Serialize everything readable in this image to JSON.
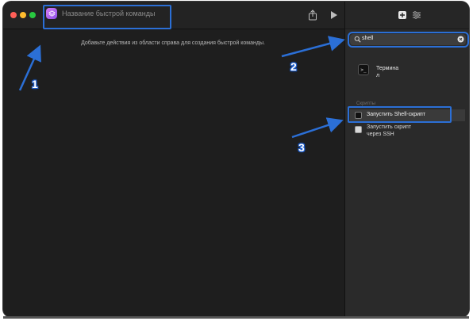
{
  "window": {
    "title": "Название быстрой команды",
    "placeholder_text": "Добавьте действия из области справа для создания быстрой команды."
  },
  "sidebar": {
    "search": {
      "value": "shell"
    },
    "results": [
      {
        "icon": "terminal-icon",
        "label": "Термина\nл"
      }
    ],
    "section_title": "Скрипты",
    "actions": [
      {
        "icon": "script-icon",
        "label": "Запустить Shell-скрипт"
      },
      {
        "icon": "ssh-icon",
        "label": "Запустить скрипт через SSH"
      }
    ]
  },
  "annotations": {
    "markers": [
      "1",
      "2",
      "3"
    ],
    "color": "#2b6fd6"
  },
  "colors": {
    "background": "#1e1e1e",
    "sidebar": "#2a2a2a",
    "accent": "#2b6fd6"
  }
}
